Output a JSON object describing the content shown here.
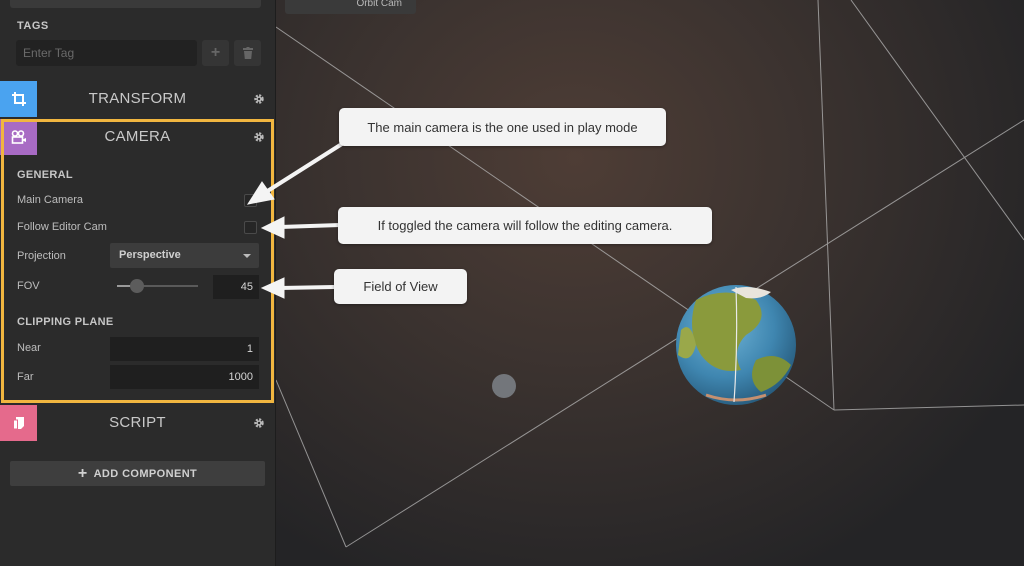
{
  "tags": {
    "label": "TAGS",
    "placeholder": "Enter Tag",
    "add_icon": "plus-icon",
    "delete_icon": "trash-icon"
  },
  "transform": {
    "title": "TRANSFORM",
    "color": "#4aa3f0",
    "icon": "transform-crop-icon"
  },
  "camera": {
    "title": "CAMERA",
    "color": "#a86bc4",
    "icon": "video-camera-icon",
    "highlight_color": "#f1b640",
    "general_label": "GENERAL",
    "main_camera_label": "Main Camera",
    "main_camera_checked": false,
    "follow_label": "Follow Editor Cam",
    "follow_checked": false,
    "projection_label": "Projection",
    "projection_value": "Perspective",
    "fov_label": "FOV",
    "fov_value": "45",
    "fov_slider_fraction": 0.25,
    "clipping_label": "CLIPPING PLANE",
    "near_label": "Near",
    "near_value": "1",
    "far_label": "Far",
    "far_value": "1000"
  },
  "script": {
    "title": "SCRIPT",
    "color": "#e56a8c",
    "icon": "script-file-icon"
  },
  "add_component": {
    "label": "ADD COMPONENT",
    "icon": "plus-icon"
  },
  "viewport": {
    "orbit_tab_label": "Orbit Cam"
  },
  "callouts": {
    "main_camera": "The main camera is the one used in play mode",
    "follow": "If toggled the camera will follow the editing camera.",
    "fov": "Field of View"
  }
}
